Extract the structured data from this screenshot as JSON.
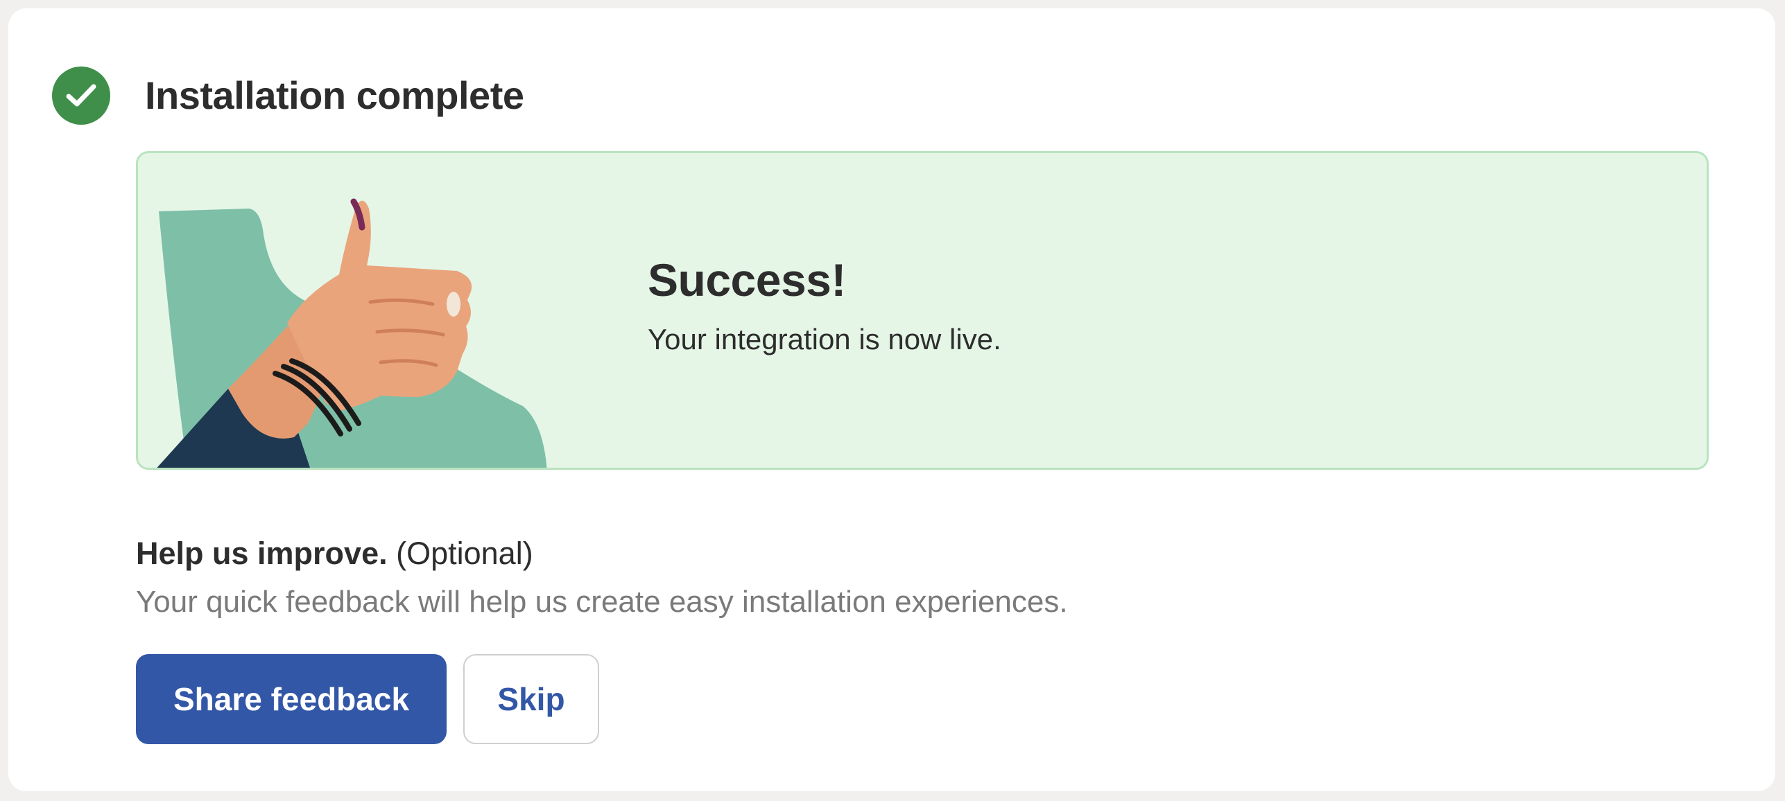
{
  "header": {
    "title": "Installation complete",
    "icon": "check-circle-icon",
    "icon_color": "#3f8f4a"
  },
  "banner": {
    "heading": "Success!",
    "message": "Your integration is now live.",
    "illustration": "thumbs-up-illustration",
    "background_color": "#e5f6e7",
    "border_color": "#b9e3bf"
  },
  "feedback": {
    "title": "Help us improve.",
    "optional": "(Optional)",
    "description": "Your quick feedback will help us create easy installation experiences."
  },
  "actions": {
    "primary_label": "Share feedback",
    "secondary_label": "Skip",
    "accent_color": "#3357a7"
  }
}
